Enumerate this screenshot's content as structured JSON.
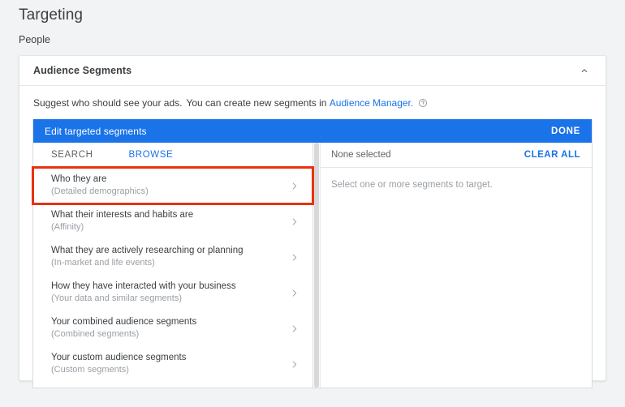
{
  "page": {
    "title": "Targeting",
    "section_label": "People"
  },
  "card": {
    "header_title": "Audience Segments",
    "collapse_icon": "chevron-up-icon",
    "suggest_text_part1": "Suggest who should see your ads.",
    "suggest_text_part2": "You can create new segments in",
    "audience_manager_link": "Audience Manager.",
    "help_icon": "help-circle-icon"
  },
  "editor": {
    "bar_title": "Edit targeted segments",
    "done_label": "DONE",
    "tabs": [
      {
        "label": "SEARCH",
        "active": false
      },
      {
        "label": "BROWSE",
        "active": true
      }
    ],
    "segments": [
      {
        "title": "Who they are",
        "subtitle": "(Detailed demographics)",
        "highlighted": true
      },
      {
        "title": "What their interests and habits are",
        "subtitle": "(Affinity)",
        "highlighted": false
      },
      {
        "title": "What they are actively researching or planning",
        "subtitle": "(In-market and life events)",
        "highlighted": false
      },
      {
        "title": "How they have interacted with your business",
        "subtitle": "(Your data and similar segments)",
        "highlighted": false
      },
      {
        "title": "Your combined audience segments",
        "subtitle": "(Combined segments)",
        "highlighted": false
      },
      {
        "title": "Your custom audience segments",
        "subtitle": "(Custom segments)",
        "highlighted": false
      }
    ],
    "selection": {
      "status": "None selected",
      "clear_all_label": "CLEAR ALL",
      "placeholder": "Select one or more segments to target."
    }
  },
  "colors": {
    "accent_blue": "#1a73e8",
    "highlight_red": "#e8330f",
    "page_background": "#f1f3f4"
  }
}
